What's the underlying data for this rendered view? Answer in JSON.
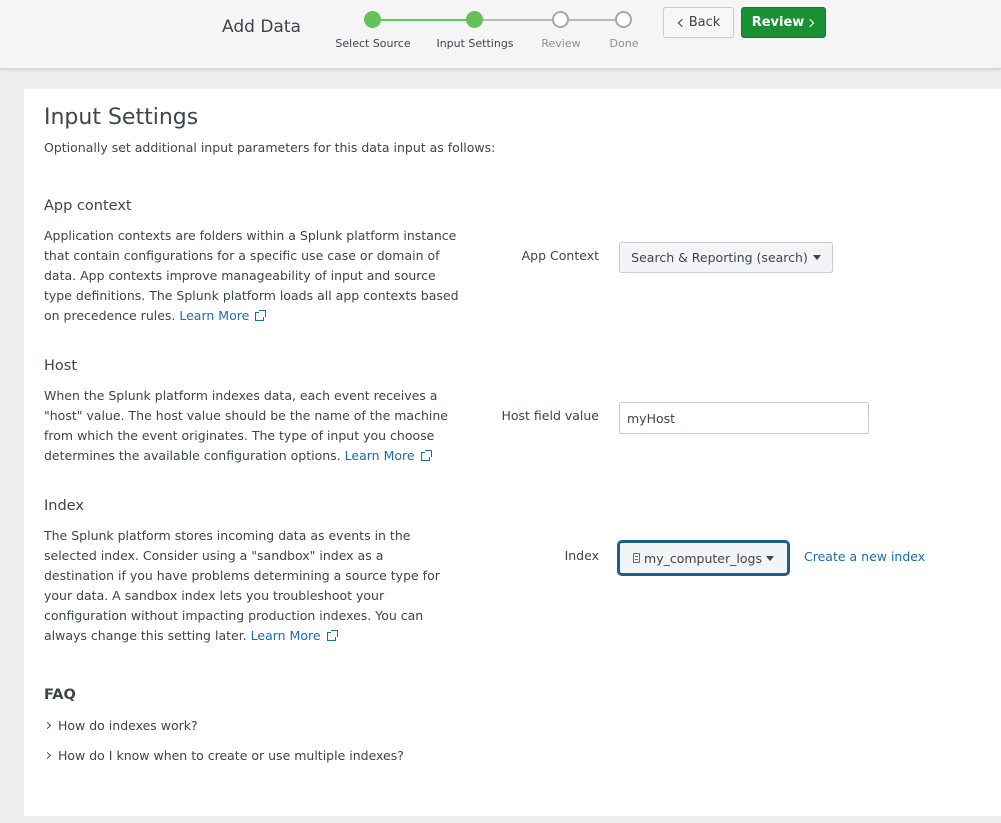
{
  "header": {
    "title": "Add Data",
    "steps": [
      {
        "label": "Select Source",
        "state": "done"
      },
      {
        "label": "Input Settings",
        "state": "done"
      },
      {
        "label": "Review",
        "state": "todo"
      },
      {
        "label": "Done",
        "state": "todo"
      }
    ],
    "back_label": "Back",
    "review_label": "Review"
  },
  "colors": {
    "accent_green": "#1a9035",
    "step_green": "#65c15a",
    "link_blue": "#1a6bb0",
    "focus_border": "#1c5f8f"
  },
  "main": {
    "title": "Input Settings",
    "subtitle": "Optionally set additional input parameters for this data input as follows:",
    "app_context": {
      "heading": "App context",
      "description": "Application contexts are folders within a Splunk platform instance that contain configurations for a specific use case or domain of data. App contexts improve manageability of input and source type definitions. The Splunk platform loads all app contexts based on precedence rules.",
      "learn_more": "Learn More",
      "field_label": "App Context",
      "selected": "Search & Reporting (search)"
    },
    "host": {
      "heading": "Host",
      "description": "When the Splunk platform indexes data, each event receives a \"host\" value. The host value should be the name of the machine from which the event originates. The type of input you choose determines the available configuration options.",
      "learn_more": "Learn More",
      "field_label": "Host field value",
      "value": "myHost"
    },
    "index": {
      "heading": "Index",
      "description": "The Splunk platform stores incoming data as events in the selected index. Consider using a \"sandbox\" index as a destination if you have problems determining a source type for your data. A sandbox index lets you troubleshoot your configuration without impacting production indexes. You can always change this setting later.",
      "learn_more": "Learn More",
      "field_label": "Index",
      "selected": "my_computer_logs",
      "create_link": "Create a new index"
    },
    "faq": {
      "heading": "FAQ",
      "items": [
        "How do indexes work?",
        "How do I know when to create or use multiple indexes?"
      ]
    }
  }
}
